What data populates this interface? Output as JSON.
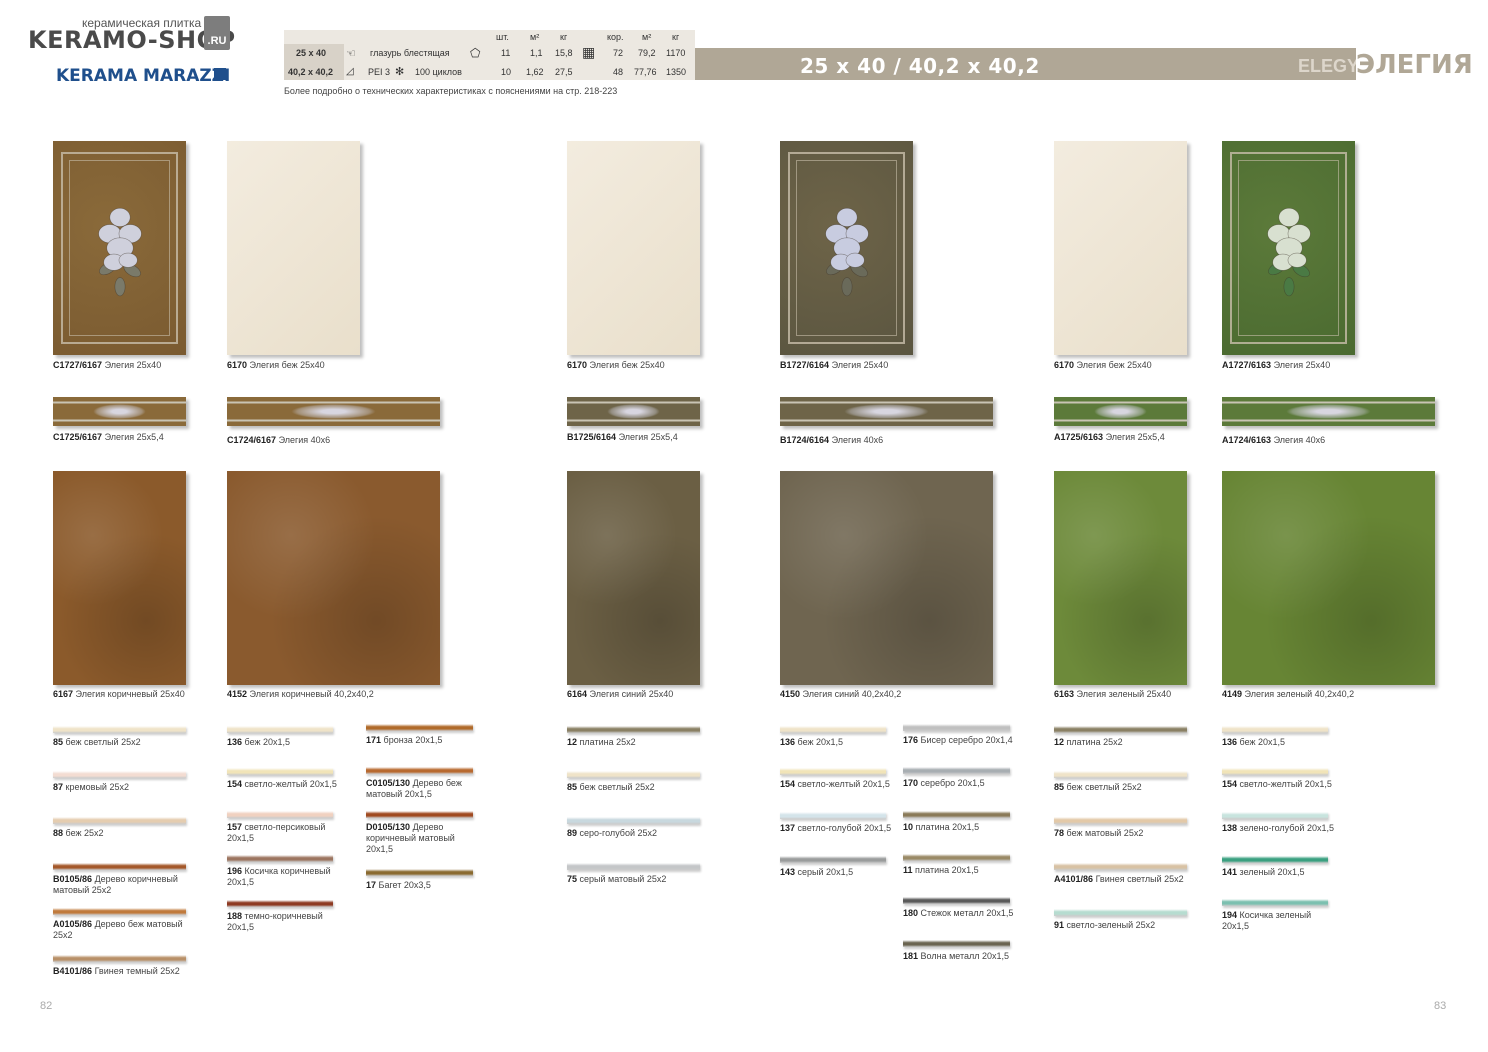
{
  "header": {
    "shop_tagline": "керамическая плитка",
    "shop_name": "KERAMO-SHOP",
    "shop_tld": ".RU",
    "brand": "KERAMA MARAZZI",
    "tech": {
      "col_heads": [
        "шт.",
        "м²",
        "кг",
        "кор.",
        "м²",
        "кг"
      ],
      "row1": {
        "size": "25 x 40",
        "desc": "глазурь блестящая",
        "v": [
          "11",
          "1,1",
          "15,8",
          "72",
          "79,2",
          "1170"
        ]
      },
      "row2": {
        "size": "40,2 x 40,2",
        "pei": "PEI 3",
        "cycles": "100 циклов",
        "v": [
          "10",
          "1,62",
          "27,5",
          "48",
          "77,76",
          "1350"
        ]
      }
    },
    "note": "Более подробно о технических характеристиках с пояснениями на стр. 218-223",
    "banner_size": "25 x 40 / 40,2 x 40,2",
    "banner_en": "ELEGY",
    "banner_ru": "ЭЛЕГИЯ"
  },
  "tiles": [
    {
      "code": "C1727/6167",
      "name": "Элегия 25x40",
      "color": "#8a6a3a"
    },
    {
      "code": "6170",
      "name": "Элегия беж 25x40",
      "color": "#efe7d6"
    },
    {
      "code": "6170",
      "name": "Элегия беж 25x40",
      "color": "#efe7d6"
    },
    {
      "code": "B1727/6164",
      "name": "Элегия 25x40",
      "color": "#6e6448"
    },
    {
      "code": "6170",
      "name": "Элегия беж 25x40",
      "color": "#efe7d6"
    },
    {
      "code": "A1727/6163",
      "name": "Элегия 25x40",
      "color": "#5c7a3a"
    }
  ],
  "borders": [
    {
      "code": "C1725/6167",
      "name": "Элегия 25x5,4"
    },
    {
      "code": "C1724/6167",
      "name": "Элегия 40x6"
    },
    {
      "code": "B1725/6164",
      "name": "Элегия 25x5,4"
    },
    {
      "code": "B1724/6164",
      "name": "Элегия 40x6"
    },
    {
      "code": "A1725/6163",
      "name": "Элегия 25x5,4"
    },
    {
      "code": "A1724/6163",
      "name": "Элегия 40x6"
    }
  ],
  "floor": [
    {
      "code": "6167",
      "name": "Элегия коричневый 25x40",
      "color": "#8b5a2b"
    },
    {
      "code": "4152",
      "name": "Элегия коричневый 40,2x40,2",
      "color": "#8a5a2e"
    },
    {
      "code": "6164",
      "name": "Элегия синий 25x40",
      "color": "#6b5f44"
    },
    {
      "code": "4150",
      "name": "Элегия синий  40,2x40,2",
      "color": "#6f6550"
    },
    {
      "code": "6163",
      "name": "Элегия зеленый 25x40",
      "color": "#6d8a3a"
    },
    {
      "code": "4149",
      "name": "Элегия зеленый 40,2x40,2",
      "color": "#678534"
    }
  ],
  "accessories": {
    "col1": [
      {
        "code": "85",
        "name": "беж светлый 25x2",
        "color": "#efe3c8"
      },
      {
        "code": "87",
        "name": "кремовый 25x2",
        "color": "#f3dcd2"
      },
      {
        "code": "88",
        "name": "беж 25x2",
        "color": "#e5cdb0"
      },
      {
        "code": "B0105/86",
        "name": "Дерево коричневый матовый 25x2",
        "color": "#a4582a"
      },
      {
        "code": "A0105/86",
        "name": "Дерево беж матовый 25x2",
        "color": "#c07a3c"
      },
      {
        "code": "B4101/86",
        "name": "Гвинея темный 25x2",
        "color": "#b89068"
      }
    ],
    "col2": [
      {
        "code": "136",
        "name": "беж 20x1,5",
        "color": "#efe3c8"
      },
      {
        "code": "154",
        "name": "светло-желтый 20x1,5",
        "color": "#f1e4b8"
      },
      {
        "code": "157",
        "name": "светло-персиковый 20x1,5",
        "color": "#f0d1c0"
      },
      {
        "code": "196",
        "name": "Косичка коричневый 20x1,5",
        "color": "#9c7560"
      },
      {
        "code": "188",
        "name": "темно-коричневый 20x1,5",
        "color": "#8e3a22"
      }
    ],
    "col3": [
      {
        "code": "171",
        "name": "бронза 20x1,5",
        "color": "#b06a2a"
      },
      {
        "code": "C0105/130",
        "name": "Дерево беж матовый 20x1,5",
        "color": "#b86a30"
      },
      {
        "code": "D0105/130",
        "name": "Дерево коричневый матовый 20x1,5",
        "color": "#a04a20"
      },
      {
        "code": "17",
        "name": "Багет 20x3,5",
        "color": "#8a6a30"
      }
    ],
    "col4": [
      {
        "code": "12",
        "name": "платина 25x2",
        "color": "#8a8064"
      },
      {
        "code": "85",
        "name": "беж светлый 25x2",
        "color": "#efe3c8"
      },
      {
        "code": "89",
        "name": "серо-голубой 25x2",
        "color": "#c8d8de"
      },
      {
        "code": "75",
        "name": "серый матовый 25x2",
        "color": "#c4c6c8"
      }
    ],
    "col5": [
      {
        "code": "136",
        "name": "беж 20x1,5",
        "color": "#efe3c8"
      },
      {
        "code": "154",
        "name": "светло-желтый 20x1,5",
        "color": "#f1e4b8"
      },
      {
        "code": "137",
        "name": "светло-голубой 20x1,5",
        "color": "#d4e4ea"
      },
      {
        "code": "143",
        "name": "серый 20x1,5",
        "color": "#9a9c9c"
      }
    ],
    "col6": [
      {
        "code": "176",
        "name": "Бисер серебро 20x1,4",
        "color": "#c0c0c0"
      },
      {
        "code": "170",
        "name": "серебро 20x1,5",
        "color": "#a8aeb2"
      },
      {
        "code": "10",
        "name": "платина 20x1,5",
        "color": "#8a7a58"
      },
      {
        "code": "11",
        "name": "платина 20x1,5",
        "color": "#9a8a66"
      },
      {
        "code": "180",
        "name": "Стежок металл 20x1,5",
        "color": "#5a5a5a"
      },
      {
        "code": "181",
        "name": "Волна металл 20x1,5",
        "color": "#6a6450"
      }
    ],
    "col7": [
      {
        "code": "12",
        "name": "платина 25x2",
        "color": "#8a8064"
      },
      {
        "code": "85",
        "name": "беж светлый 25x2",
        "color": "#efe3c8"
      },
      {
        "code": "78",
        "name": "беж матовый 25x2",
        "color": "#e3c9a8"
      },
      {
        "code": "A4101/86",
        "name": "Гвинея светлый 25x2",
        "color": "#d8c2a4"
      },
      {
        "code": "91",
        "name": "светло-зеленый 25x2",
        "color": "#b6dcd0"
      }
    ],
    "col8": [
      {
        "code": "136",
        "name": "беж 20x1,5",
        "color": "#efe3c8"
      },
      {
        "code": "154",
        "name": "светло-желтый 20x1,5",
        "color": "#f1e4b8"
      },
      {
        "code": "138",
        "name": "зелено-голубой 20x1,5",
        "color": "#c8e4de"
      },
      {
        "code": "141",
        "name": "зеленый 20x1,5",
        "color": "#3aa080"
      },
      {
        "code": "194",
        "name": "Косичка зеленый 20x1,5",
        "color": "#7cc0b0"
      }
    ]
  },
  "page_numbers": {
    "left": "82",
    "right": "83"
  }
}
